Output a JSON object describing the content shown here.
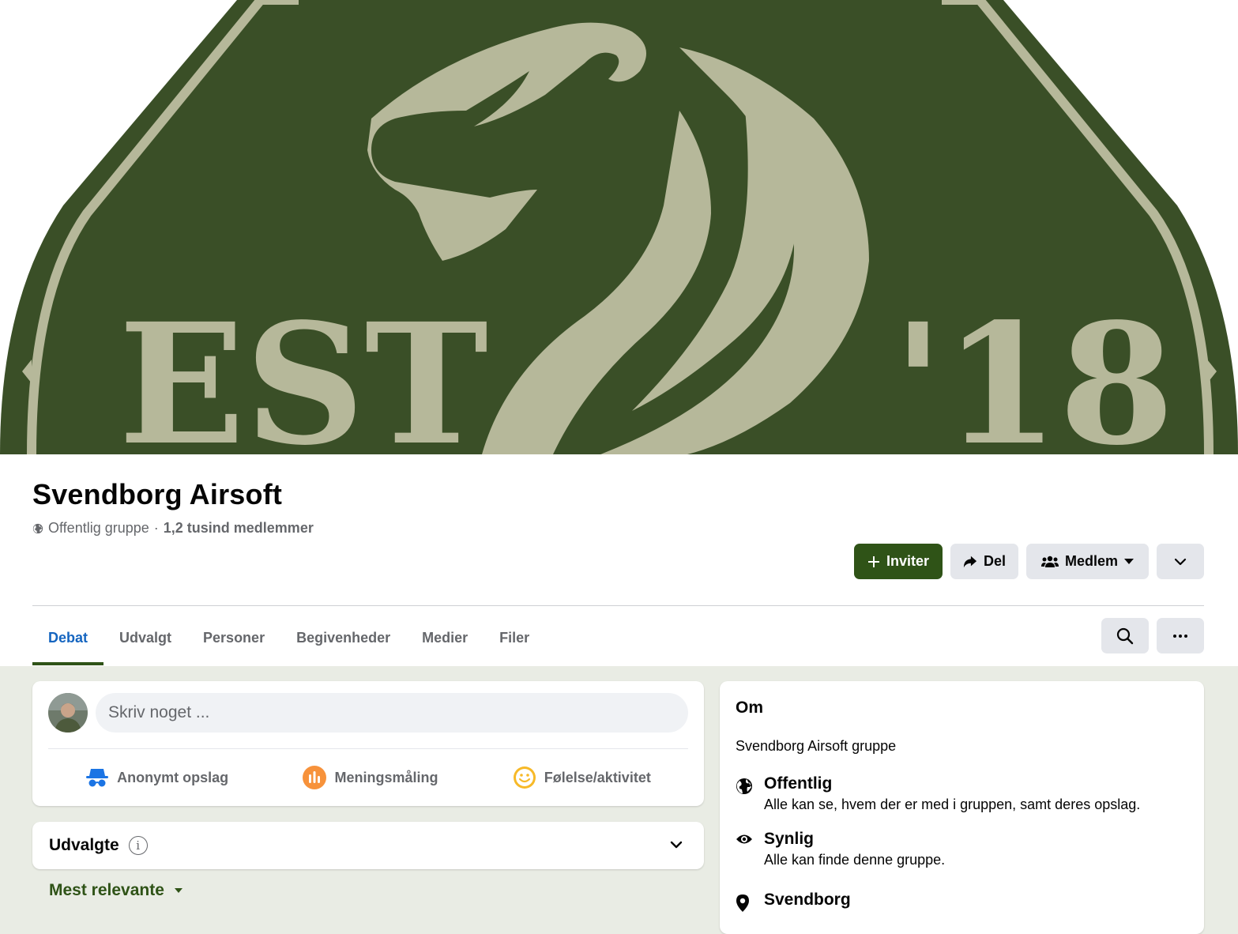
{
  "cover": {
    "left_text": "EST",
    "right_text": "'18",
    "colors": {
      "green": "#3a4f27",
      "khaki": "#b6b89a"
    }
  },
  "group": {
    "name": "Svendborg Airsoft",
    "privacy": "Offentlig gruppe",
    "separator": "·",
    "members": "1,2 tusind medlemmer"
  },
  "actions": {
    "invite": "Inviter",
    "share": "Del",
    "member": "Medlem"
  },
  "tabs": [
    "Debat",
    "Udvalgt",
    "Personer",
    "Begivenheder",
    "Medier",
    "Filer"
  ],
  "active_tab": "Debat",
  "composer": {
    "placeholder": "Skriv noget ...",
    "options": [
      "Anonymt opslag",
      "Meningsmåling",
      "Følelse/aktivitet"
    ]
  },
  "featured": {
    "title": "Udvalgte",
    "info": "i"
  },
  "sort": {
    "label": "Mest relevante"
  },
  "about": {
    "title": "Om",
    "description": "Svendborg Airsoft gruppe",
    "rows": [
      {
        "title": "Offentlig",
        "text": "Alle kan se, hvem der er med i gruppen, samt deres opslag.",
        "icon": "globe-icon"
      },
      {
        "title": "Synlig",
        "text": "Alle kan finde denne gruppe.",
        "icon": "eye-icon"
      },
      {
        "title": "Svendborg",
        "text": "",
        "icon": "location-pin-icon"
      }
    ]
  },
  "colors": {
    "accent": "#2f5317",
    "active_tab": "#1565c0",
    "page_bg": "#e9ece4"
  }
}
